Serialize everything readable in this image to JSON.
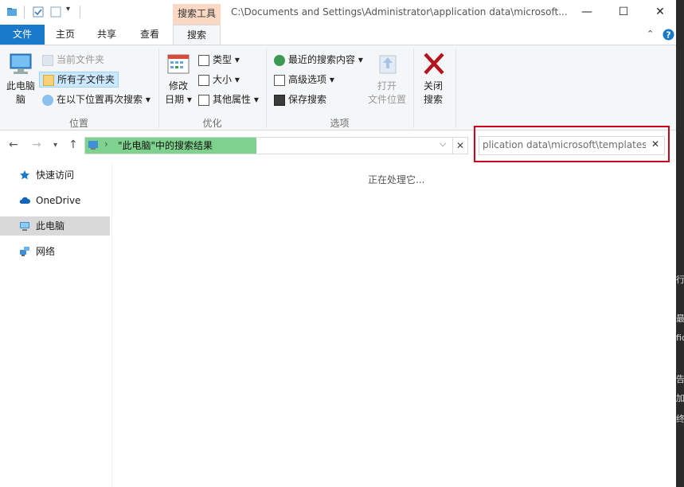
{
  "window": {
    "title": "C:\\Documents and Settings\\Administrator\\application data\\microsoft...",
    "contextual_tab": "搜索工具",
    "controls": {
      "minimize": "—",
      "maximize": "☐",
      "close": "✕"
    }
  },
  "tabs": {
    "file": "文件",
    "home": "主页",
    "share": "共享",
    "view": "查看",
    "search": "搜索"
  },
  "ribbon": {
    "location": {
      "this_pc": "此电脑",
      "this_pc2": "脑",
      "current_folder": "当前文件夹",
      "all_subfolders": "所有子文件夹",
      "search_again_in": "在以下位置再次搜索",
      "group_label": "位置"
    },
    "refine": {
      "date_modified_line1": "修改",
      "date_modified_line2": "日期",
      "kind": "类型",
      "size": "大小",
      "other_props": "其他属性",
      "group_label": "优化"
    },
    "options": {
      "recent_searches": "最近的搜索内容",
      "advanced_options": "高级选项",
      "save_search": "保存搜索",
      "open_location_line1": "打开",
      "open_location_line2": "文件位置",
      "group_label": "选项"
    },
    "close": {
      "line1": "关闭",
      "line2": "搜索"
    }
  },
  "navigation": {
    "address": "\"此电脑\"中的搜索结果",
    "search_value": "plication data\\microsoft\\templates"
  },
  "sidebar": {
    "items": [
      {
        "label": "快速访问",
        "icon": "star-icon"
      },
      {
        "label": "OneDrive",
        "icon": "cloud-icon"
      },
      {
        "label": "此电脑",
        "icon": "computer-icon"
      },
      {
        "label": "网络",
        "icon": "network-icon"
      }
    ]
  },
  "main": {
    "status": "正在处理它..."
  },
  "background_text": [
    "行",
    "最",
    "fic",
    "告",
    "加",
    "终"
  ],
  "colors": {
    "accent": "#1979ca",
    "context_tab": "#fbd8c4",
    "address_progress": "#7fd28e",
    "highlight": "#d0021b"
  }
}
